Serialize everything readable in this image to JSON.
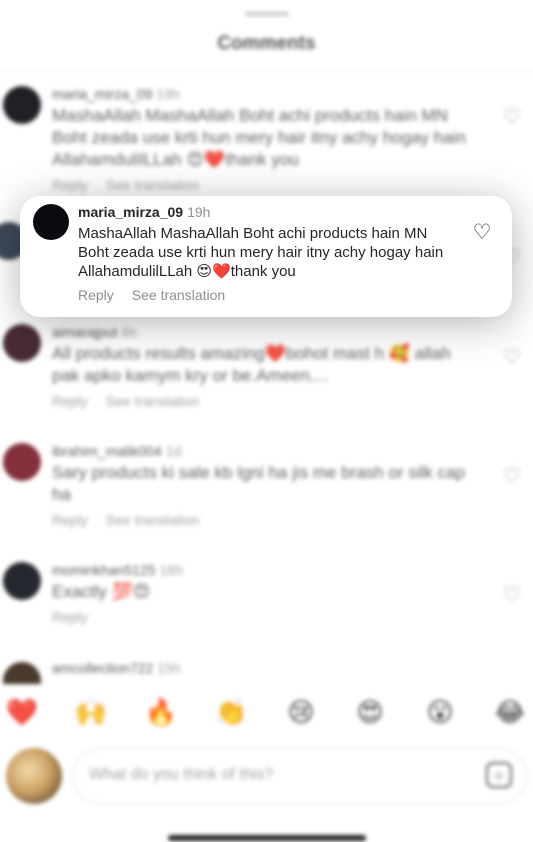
{
  "header": {
    "title": "Comments"
  },
  "comments": [
    {
      "user": "maria_mirza_09",
      "time": "19h",
      "text": "MashaAllah MashaAllah Boht achi products hain MN Boht zeada use krti hun mery hair itny achy hogay hain AllahamdulilLLah 😍❤️thank you",
      "reply": "Reply",
      "translate": "See translation"
    },
    {
      "user": "aimarajput",
      "time": "6h",
      "text": "All products results amazing❤️bohot mast h 🥰 allah pak apko kamym kry or be.Ameen....",
      "reply": "Reply",
      "translate": "See translation"
    },
    {
      "user": "ibrahim_malik004",
      "time": "1d",
      "text": "Sary products ki sale kb lgni ha jis me brash or silk cap ha",
      "reply": "Reply",
      "translate": "See translation"
    },
    {
      "user": "mominkhan5125",
      "time": "16h",
      "text": "Exactly 💯😍",
      "reply": "Reply"
    },
    {
      "user": "amcollection722",
      "time": "15h"
    }
  ],
  "highlighted": {
    "user": "maria_mirza_09",
    "time": "19h",
    "text": "MashaAllah MashaAllah Boht achi products hain MN Boht zeada use krti hun mery hair itny achy hogay hain AllahamdulilLLah 😍❤️thank you",
    "reply": "Reply",
    "translate": "See translation"
  },
  "reactions": [
    "❤️",
    "🙌",
    "🔥",
    "👏",
    "😢",
    "😍",
    "😮",
    "😂"
  ],
  "composer": {
    "placeholder": "What do you think of this?"
  }
}
